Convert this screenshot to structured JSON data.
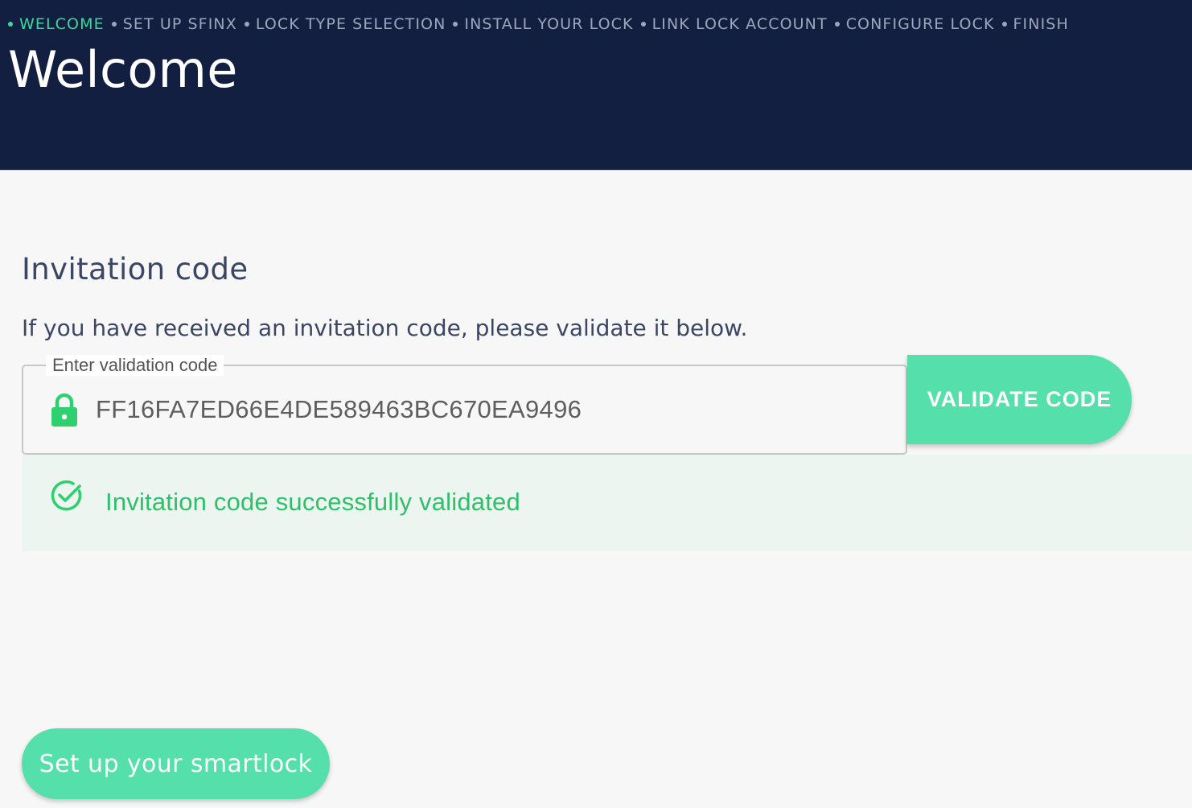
{
  "header": {
    "steps": [
      {
        "label": "WELCOME",
        "active": true
      },
      {
        "label": "SET UP SFINX",
        "active": false
      },
      {
        "label": "LOCK TYPE SELECTION",
        "active": false
      },
      {
        "label": "INSTALL YOUR LOCK",
        "active": false
      },
      {
        "label": "LINK LOCK ACCOUNT",
        "active": false
      },
      {
        "label": "CONFIGURE LOCK",
        "active": false
      },
      {
        "label": "FINISH",
        "active": false
      }
    ],
    "title": "Welcome"
  },
  "invitation": {
    "title": "Invitation code",
    "description": "If you have received an invitation code, please validate it below.",
    "field_label": "Enter validation code",
    "field_value": "FF16FA7ED66E4DE589463BC670EA9496",
    "lock_icon": "lock-icon",
    "validate_label": "VALIDATE CODE",
    "success_icon": "check-circle-icon",
    "success_text": "Invitation code successfully validated"
  },
  "footer": {
    "setup_label": "Set up your smartlock"
  },
  "colors": {
    "header_bg": "#131f41",
    "accent": "#55dfaa",
    "active_step": "#3fd69b",
    "success_text": "#2fbf6a",
    "success_bg": "#ecf5ef",
    "heading": "#3b4663"
  }
}
